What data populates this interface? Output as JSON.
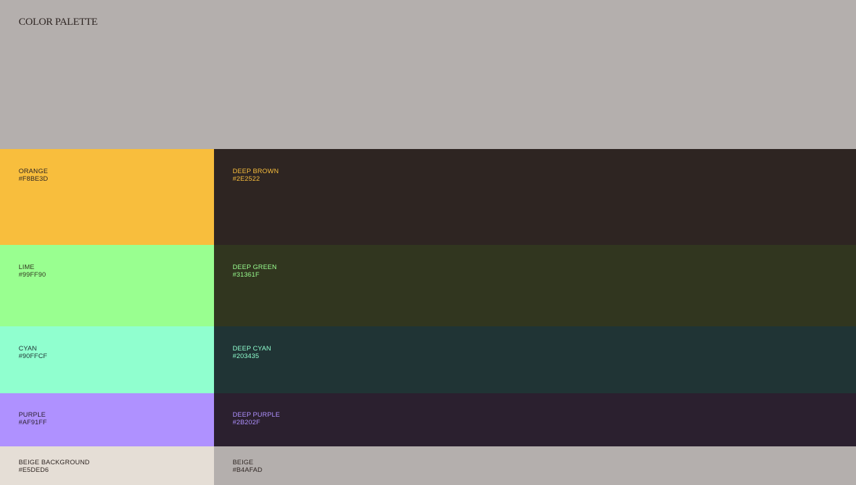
{
  "title": "COLOR PALETTE",
  "rows": [
    {
      "left": {
        "name": "ORANGE",
        "hex": "#F8BE3D",
        "bg": "#F8BE3D",
        "text": "#2E2522"
      },
      "right": {
        "name": "DEEP BROWN",
        "hex": "#2E2522",
        "bg": "#2E2522",
        "text": "#F8BE3D"
      }
    },
    {
      "left": {
        "name": "LIME",
        "hex": "#99FF90",
        "bg": "#99FF90",
        "text": "#31361F"
      },
      "right": {
        "name": "DEEP GREEN",
        "hex": "#31361F",
        "bg": "#31361F",
        "text": "#99FF90"
      }
    },
    {
      "left": {
        "name": "CYAN",
        "hex": "#90FFCF",
        "bg": "#90FFCF",
        "text": "#203435"
      },
      "right": {
        "name": "DEEP CYAN",
        "hex": "#203435",
        "bg": "#203435",
        "text": "#90FFCF"
      }
    },
    {
      "left": {
        "name": "PURPLE",
        "hex": "#AF91FF",
        "bg": "#AF91FF",
        "text": "#2B202F"
      },
      "right": {
        "name": "DEEP PURPLE",
        "hex": "#2B202F",
        "bg": "#2B202F",
        "text": "#AF91FF"
      }
    },
    {
      "left": {
        "name": "BEIGE BACKGROUND",
        "hex": "#E5DED6",
        "bg": "#E5DED6",
        "text": "#2E2522"
      },
      "right": {
        "name": "BEIGE",
        "hex": "#B4AFAD",
        "bg": "#B4AFAD",
        "text": "#2E2522"
      }
    }
  ]
}
